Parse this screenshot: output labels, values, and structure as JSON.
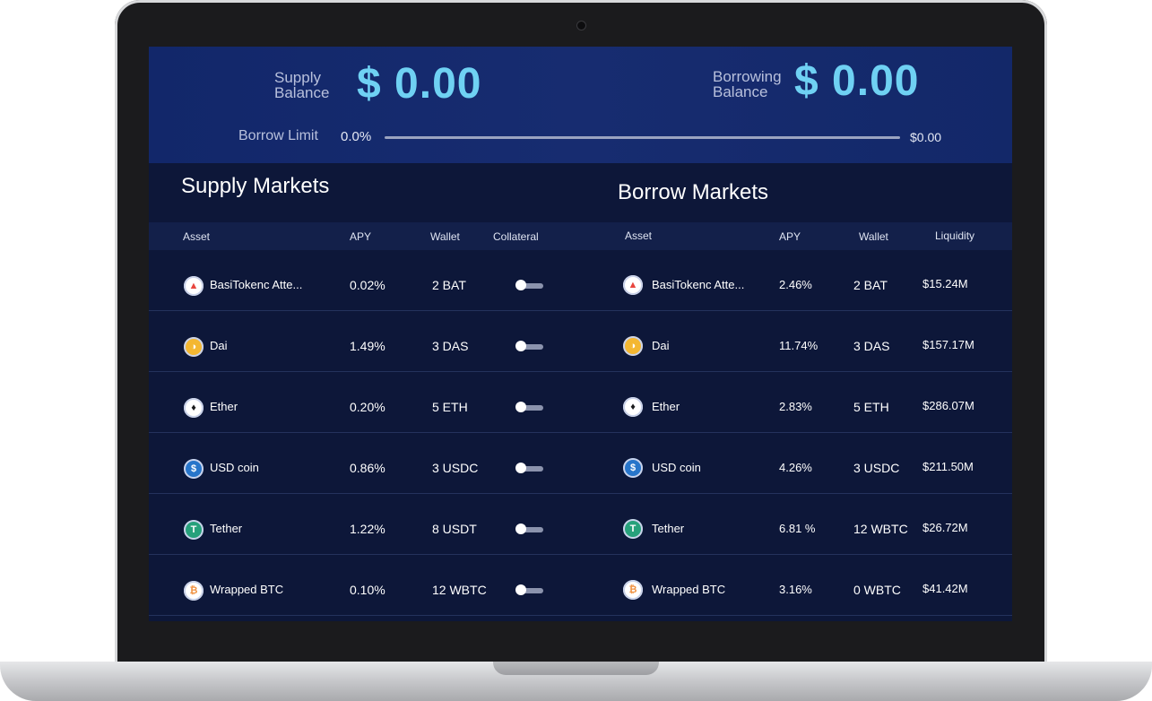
{
  "summary": {
    "supply_label_line1": "Supply",
    "supply_label_line2": "Balance",
    "supply_value": "$ 0.00",
    "borrow_label_line1": "Borrowing",
    "borrow_label_line2": "Balance",
    "borrow_value": "$ 0.00",
    "limit_label": "Borrow Limit",
    "limit_percent": "0.0%",
    "limit_max": "$0.00"
  },
  "supply_markets": {
    "title": "Supply Markets",
    "headers": {
      "asset": "Asset",
      "apy": "APY",
      "wallet": "Wallet",
      "collateral": "Collateral"
    },
    "rows": [
      {
        "asset": "BasiTokenc Atte...",
        "icon": "bat-icon",
        "apy": "0.02%",
        "wallet": "2 BAT",
        "collateral": false
      },
      {
        "asset": "Dai",
        "icon": "dai-icon",
        "apy": "1.49%",
        "wallet": "3 DAS",
        "collateral": false
      },
      {
        "asset": "Ether",
        "icon": "ether-icon",
        "apy": "0.20%",
        "wallet": "5 ETH",
        "collateral": false
      },
      {
        "asset": "USD coin",
        "icon": "usdc-icon",
        "apy": "0.86%",
        "wallet": "3 USDC",
        "collateral": false
      },
      {
        "asset": "Tether",
        "icon": "tether-icon",
        "apy": "1.22%",
        "wallet": "8 USDT",
        "collateral": false
      },
      {
        "asset": "Wrapped BTC",
        "icon": "wbtc-icon",
        "apy": "0.10%",
        "wallet": "12 WBTC",
        "collateral": false
      }
    ]
  },
  "borrow_markets": {
    "title": "Borrow Markets",
    "headers": {
      "asset": "Asset",
      "apy": "APY",
      "wallet": "Wallet",
      "liquidity": "Liquidity"
    },
    "rows": [
      {
        "asset": "BasiTokenc Atte...",
        "icon": "bat-icon",
        "apy": "2.46%",
        "wallet": "2 BAT",
        "liquidity": "$15.24M"
      },
      {
        "asset": "Dai",
        "icon": "dai-icon",
        "apy": "11.74%",
        "wallet": "3 DAS",
        "liquidity": "$157.17M"
      },
      {
        "asset": "Ether",
        "icon": "ether-icon",
        "apy": "2.83%",
        "wallet": "5 ETH",
        "liquidity": "$286.07M"
      },
      {
        "asset": "USD coin",
        "icon": "usdc-icon",
        "apy": "4.26%",
        "wallet": "3 USDC",
        "liquidity": "$211.50M"
      },
      {
        "asset": "Tether",
        "icon": "tether-icon",
        "apy": "6.81 %",
        "wallet": "12 WBTC",
        "liquidity": "$26.72M"
      },
      {
        "asset": "Wrapped BTC",
        "icon": "wbtc-icon",
        "apy": "3.16%",
        "wallet": "0 WBTC",
        "liquidity": "$41.42M"
      }
    ]
  },
  "colors": {
    "accent_value": "#6fd1f3",
    "summary_bg": "#152a6c",
    "table_bg": "#0d1739",
    "bat": "#e8463e",
    "dai": "#f4b731",
    "tether": "#26a17b",
    "usdc": "#2775ca",
    "wbtc": "#f09242"
  }
}
